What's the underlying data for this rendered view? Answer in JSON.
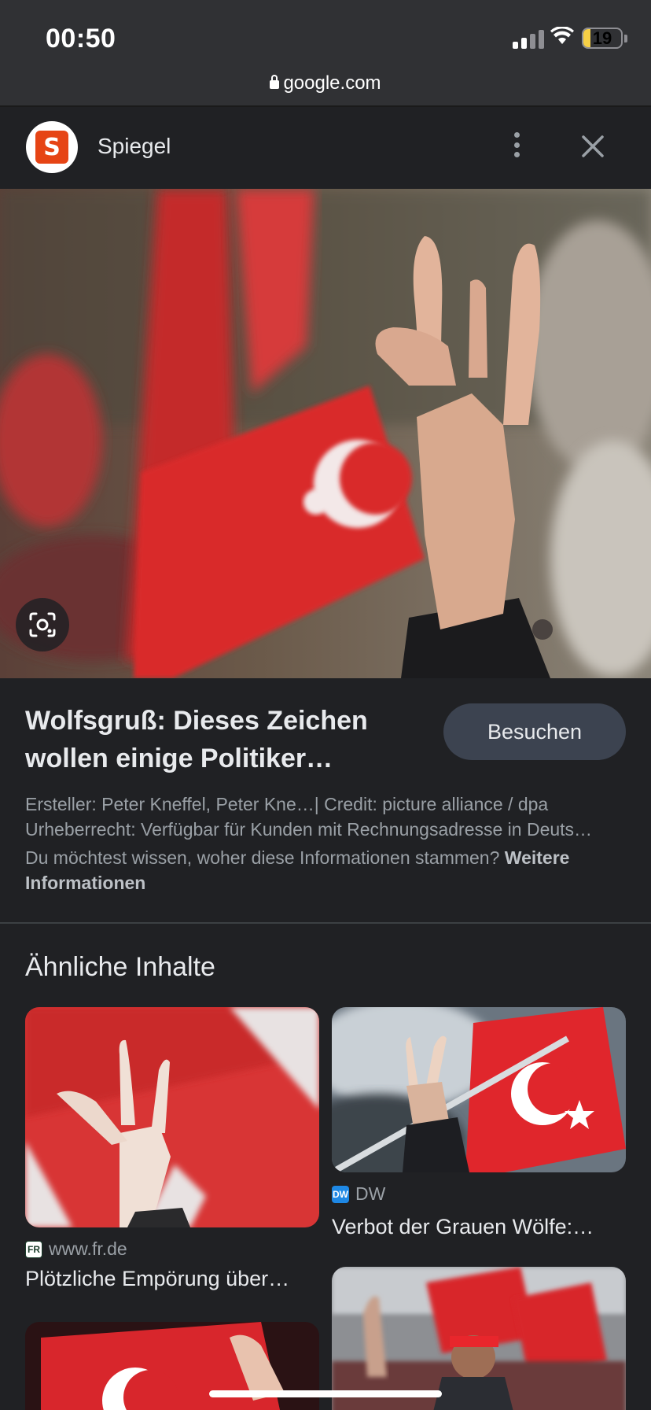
{
  "status": {
    "time": "00:50",
    "battery": "19",
    "battery_level": 0.19
  },
  "browser": {
    "url": "google.com"
  },
  "viewer": {
    "site_name": "Spiegel",
    "site_logo_letter": "S",
    "article_title": "Wolfsgruß: Dieses Zeichen wollen einige Politiker…",
    "visit_label": "Besuchen",
    "credits_line": "Ersteller: Peter Kneffel, Peter Kne…| Credit: picture alliance / dpa",
    "copyright_line": "Urheberrecht: Verfügbar für Kunden mit Rechnungsadresse in Deuts…",
    "info_question": "Du möchtest wissen, woher diese Informationen stammen?",
    "info_link": "Weitere Informationen"
  },
  "related": {
    "heading": "Ähnliche Inhalte",
    "items": [
      {
        "source": "www.fr.de",
        "title": "Plötzliche Empörung über…"
      },
      {
        "source": "DW",
        "title": "Verbot der Grauen Wölfe:…"
      }
    ]
  },
  "colors": {
    "background": "#202124",
    "status_bar": "#303134",
    "visit_button": "#3c4350",
    "spiegel_orange": "#e64415",
    "flag_red": "#d92c2c"
  }
}
